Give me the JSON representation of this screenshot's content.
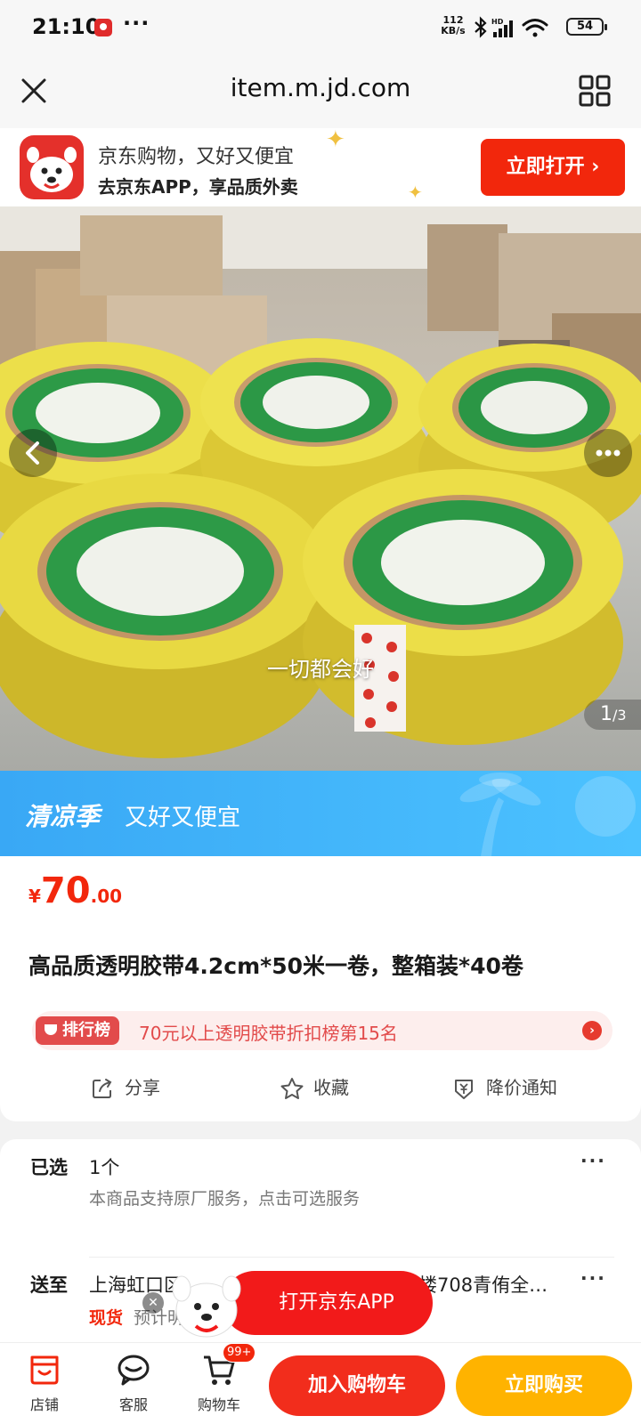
{
  "status_bar": {
    "time": "21:10",
    "dots": "···",
    "net_speed_value": "112",
    "net_speed_unit": "KB/s",
    "battery": "54"
  },
  "browser": {
    "url": "item.m.jd.com"
  },
  "app_banner": {
    "title": "京东购物，又好又便宜",
    "subtitle": "去京东APP，享品质外卖",
    "open_button": "立即打开"
  },
  "gallery": {
    "caption": "一切都会好",
    "current_page": "1",
    "total_pages": "/3"
  },
  "promo": {
    "brand": "清凉季",
    "text": "又好又便宜"
  },
  "product": {
    "price_symbol": "¥",
    "price_integer": "70",
    "price_decimal": ".00",
    "title": "高品质透明胶带4.2cm*50米一卷，整箱装*40卷",
    "rank_badge": "排行榜",
    "rank_text": "70元以上透明胶带折扣榜第15名",
    "actions": {
      "share": "分享",
      "favorite": "收藏",
      "price_alert": "降价通知"
    }
  },
  "selection": {
    "selected_label": "已选",
    "selected_value": "1个",
    "service_note": "本商品支持原厂服务，点击可选服务",
    "ship_label": "送至",
    "ship_address": "上海虹口区",
    "ship_address_tail": "楼708青侑全…",
    "stock": "现货",
    "eta": "预计明天发货，8日1日24:00前送达"
  },
  "floating": {
    "open_app": "打开京东APP"
  },
  "bottom_bar": {
    "store": "店铺",
    "service": "客服",
    "cart": "购物车",
    "cart_badge": "99+",
    "add_to_cart": "加入购物车",
    "buy_now": "立即购买"
  },
  "colors": {
    "jd_red": "#f2270c",
    "buy_yellow": "#ffb300",
    "promo_blue": "#39a8f5"
  }
}
